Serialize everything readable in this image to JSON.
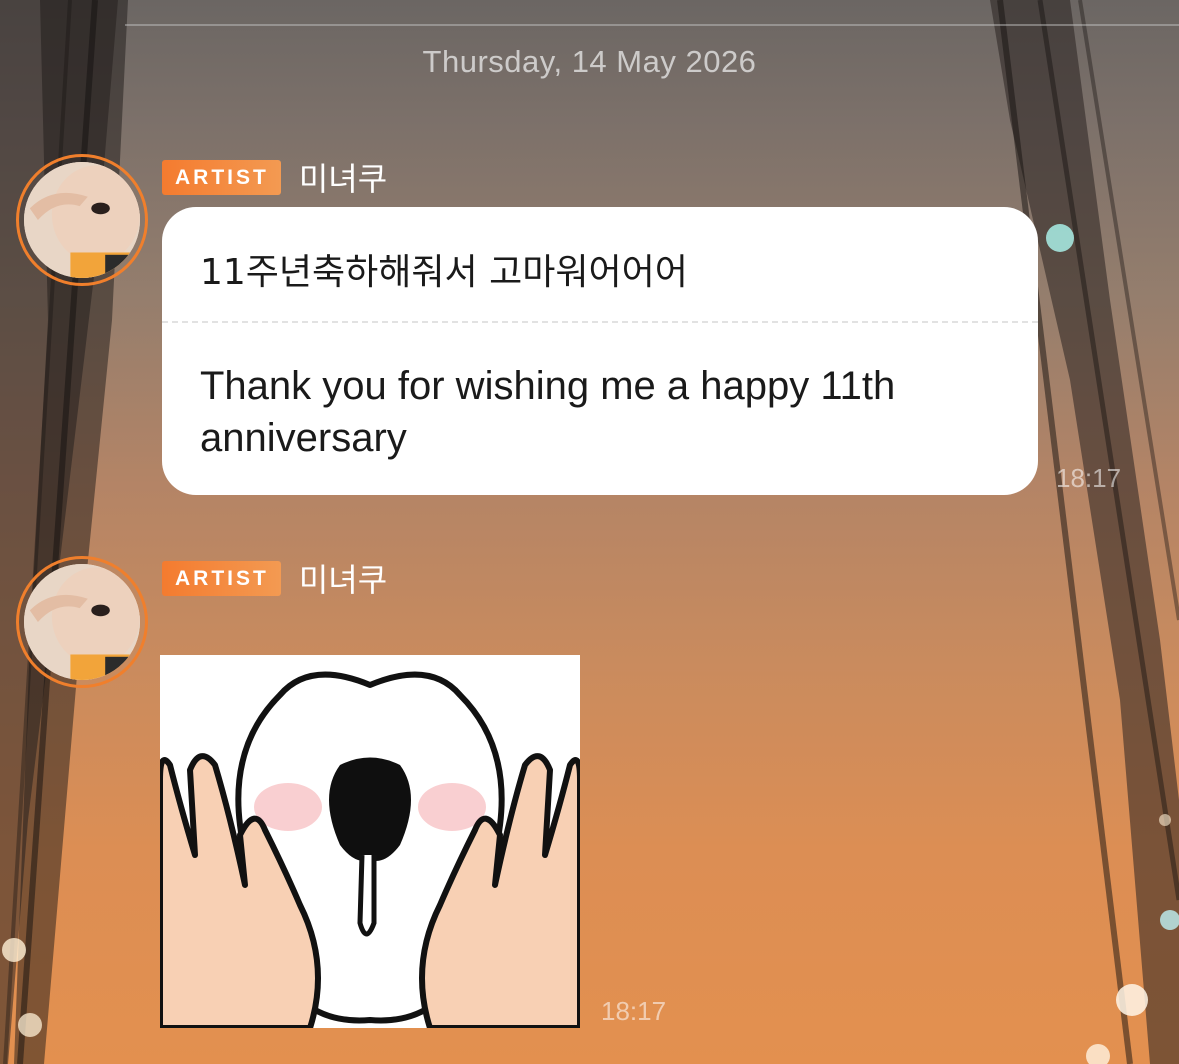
{
  "date_separator": "Thursday, 14 May 2026",
  "messages": [
    {
      "badge": "ARTIST",
      "sender": "미녀쿠",
      "text_korean": "11주년축하해줘서 고마워어어어",
      "text_translation": "Thank you for wishing me a happy 11th anniversary",
      "time": "18:17"
    },
    {
      "badge": "ARTIST",
      "sender": "미녀쿠",
      "sticker": "surprised-dog-sticker",
      "time": "18:17"
    }
  ],
  "colors": {
    "accent": "#f47b2f",
    "bubble": "#ffffff",
    "background_top": "#6b6663",
    "background_bottom": "#e3904f"
  }
}
